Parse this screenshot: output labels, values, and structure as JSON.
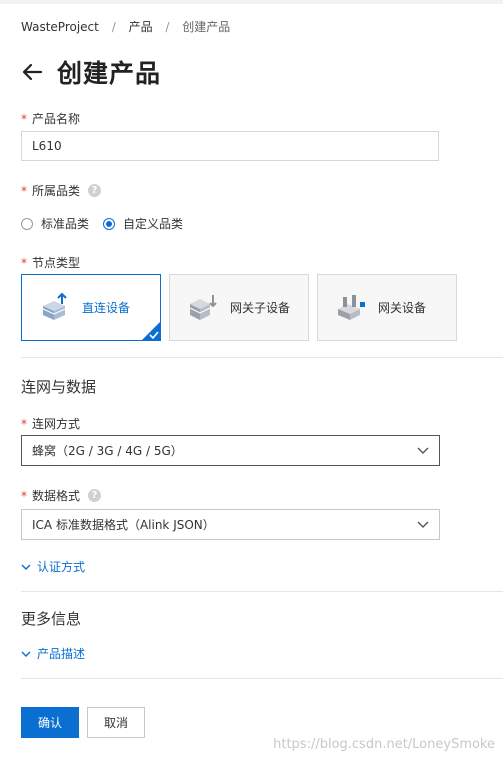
{
  "breadcrumb": {
    "items": [
      "WasteProject",
      "产品",
      "创建产品"
    ],
    "separator": "/"
  },
  "page": {
    "title": "创建产品"
  },
  "form": {
    "product_name": {
      "label": "产品名称",
      "value": "L610",
      "required": "*"
    },
    "category": {
      "label": "所属品类",
      "required": "*",
      "help": "?",
      "options": [
        {
          "label": "标准品类",
          "selected": false
        },
        {
          "label": "自定义品类",
          "selected": true
        }
      ]
    },
    "node_type": {
      "label": "节点类型",
      "required": "*",
      "cards": [
        {
          "label": "直连设备",
          "selected": true,
          "icon": "direct-device-icon"
        },
        {
          "label": "网关子设备",
          "selected": false,
          "icon": "gateway-subdevice-icon"
        },
        {
          "label": "网关设备",
          "selected": false,
          "icon": "gateway-device-icon"
        }
      ]
    }
  },
  "network_section": {
    "title": "连网与数据",
    "network_method": {
      "label": "连网方式",
      "required": "*",
      "value": "蜂窝（2G / 3G / 4G / 5G）"
    },
    "data_format": {
      "label": "数据格式",
      "required": "*",
      "help": "?",
      "value": "ICA 标准数据格式（Alink JSON）"
    },
    "auth_link": "认证方式"
  },
  "more_section": {
    "title": "更多信息",
    "desc_link": "产品描述"
  },
  "actions": {
    "confirm": "确认",
    "cancel": "取消"
  },
  "watermark": "https://blog.csdn.net/LoneySmoke",
  "colors": {
    "accent": "#0a6fd1",
    "required": "#e03a3a"
  }
}
